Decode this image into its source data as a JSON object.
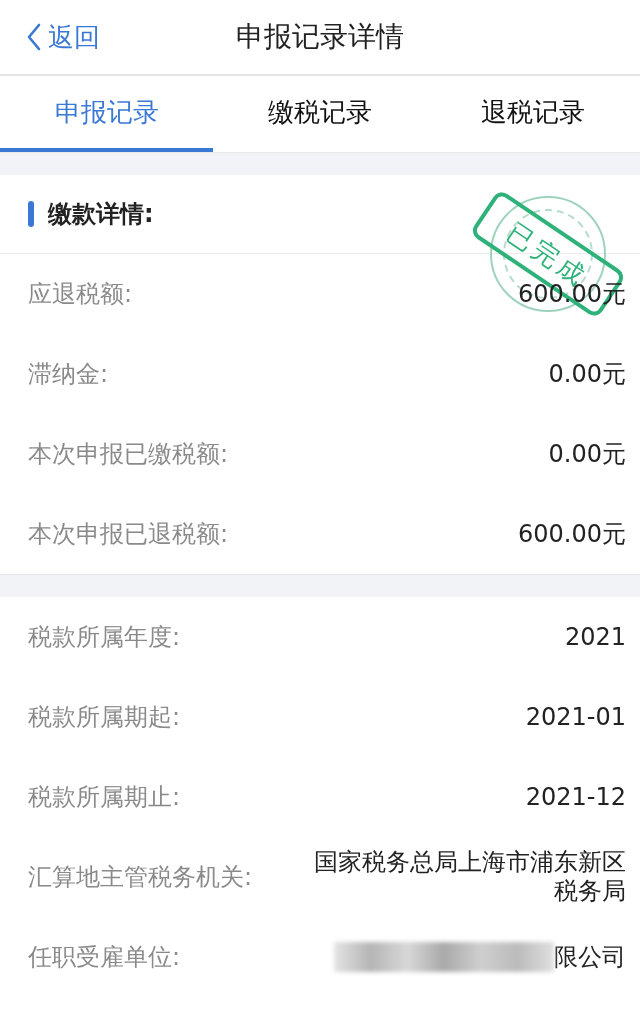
{
  "nav": {
    "back": "返回",
    "title": "申报记录详情"
  },
  "tabs": [
    {
      "label": "申报记录",
      "selected": true
    },
    {
      "label": "缴税记录",
      "selected": false
    },
    {
      "label": "退税记录",
      "selected": false
    }
  ],
  "payment": {
    "heading": "缴款详情:",
    "stamp": "已完成",
    "rows": [
      {
        "label": "应退税额:",
        "value": "600.00元"
      },
      {
        "label": "滞纳金:",
        "value": "0.00元"
      },
      {
        "label": "本次申报已缴税额:",
        "value": "0.00元"
      },
      {
        "label": "本次申报已退税额:",
        "value": "600.00元"
      }
    ]
  },
  "details": [
    {
      "label": "税款所属年度:",
      "value": "2021",
      "redacted": false
    },
    {
      "label": "税款所属期起:",
      "value": "2021-01",
      "redacted": false
    },
    {
      "label": "税款所属期止:",
      "value": "2021-12",
      "redacted": false
    },
    {
      "label": "汇算地主管税务机关:",
      "value": "国家税务总局上海市浦东新区税务局",
      "redacted": false
    },
    {
      "label": "任职受雇单位:",
      "value": "限公司",
      "redacted": true
    }
  ]
}
